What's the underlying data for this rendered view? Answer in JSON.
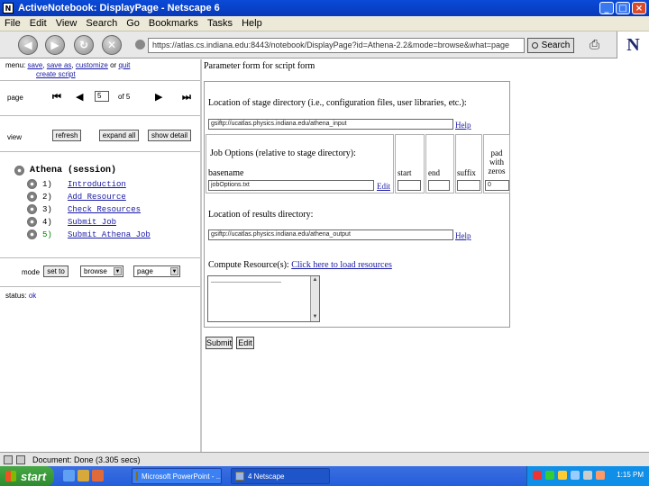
{
  "window": {
    "title": "ActiveNotebook: DisplayPage - Netscape 6",
    "controls": [
      "minimize",
      "maximize",
      "close"
    ]
  },
  "menubar": [
    "File",
    "Edit",
    "View",
    "Search",
    "Go",
    "Bookmarks",
    "Tasks",
    "Help"
  ],
  "navigation": {
    "url": "https://atlas.cs.indiana.edu:8443/notebook/DisplayPage?id=Athena-2.2&mode=browse&what=page",
    "search_label": "Search",
    "logo": "N"
  },
  "left_pane": {
    "menu_items": [
      "save",
      "save as",
      "customize",
      "quit"
    ],
    "menu_prefix": "menu:",
    "menu_link2": "create script",
    "page_label": "page",
    "page_number": "5",
    "page_of": "of 5",
    "view_label": "view",
    "view_buttons": [
      "refresh",
      "expand all",
      "show detail"
    ],
    "tree_title": "Athena (session)",
    "steps": [
      {
        "num": "1)",
        "label": "Introduction"
      },
      {
        "num": "2)",
        "label": "Add Resource"
      },
      {
        "num": "3)",
        "label": "Check Resources"
      },
      {
        "num": "4)",
        "label": "Submit Job"
      },
      {
        "num": "5)",
        "label": "Submit Athena Job"
      }
    ],
    "mode_label": "mode",
    "mode_button": "set to",
    "mode_select": "browse",
    "type_select": "page",
    "status_label": "status:",
    "status_value": "ok"
  },
  "form": {
    "title": "Parameter form for script form",
    "stage_label": "Location of stage directory (i.e., configuration files, user libraries, etc.):",
    "stage_value": "gsiftp://ucatlas.physics.indiana.edu/athena_input",
    "help": "Help",
    "job_options_label": "Job Options (relative to stage directory):",
    "col_start": "start",
    "col_end": "end",
    "col_suffix": "suffix",
    "col_pad": "pad with zeros",
    "basename_label": "basename",
    "basename_value": "jobOptions.txt",
    "edit_link": "Edit",
    "pad_value": "0",
    "results_label": "Location of results directory:",
    "results_value": "gsiftp://ucatlas.physics.indiana.edu/athena_output",
    "compute_label": "Compute Resource(s):",
    "compute_link": "Click here to load resources",
    "textarea_value": "—————————————",
    "submit": "Submit",
    "edit_button": "Edit"
  },
  "statusbar": {
    "text": "Document: Done (3.305 secs)"
  },
  "taskbar": {
    "start": "start",
    "tasks": [
      "Microsoft PowerPoint - ...",
      "4 Netscape"
    ],
    "clock": "1:15 PM"
  }
}
